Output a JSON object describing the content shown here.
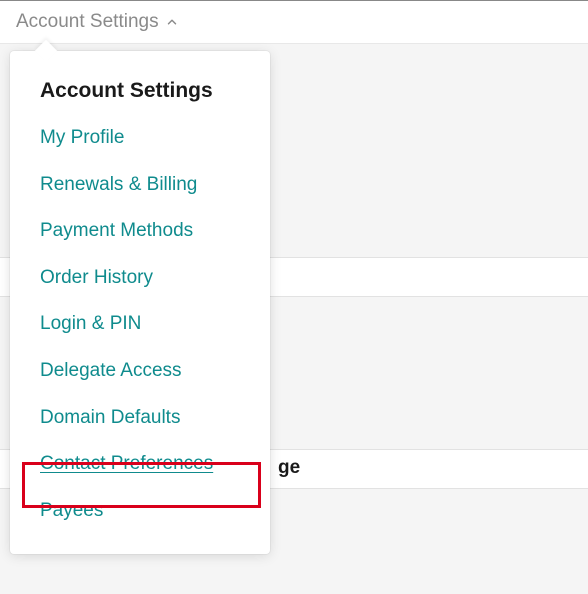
{
  "topbar": {
    "label": "Account Settings"
  },
  "dropdown": {
    "header": "Account Settings",
    "items": [
      {
        "label": "My Profile"
      },
      {
        "label": "Renewals & Billing"
      },
      {
        "label": "Payment Methods"
      },
      {
        "label": "Order History"
      },
      {
        "label": "Login & PIN"
      },
      {
        "label": "Delegate Access"
      },
      {
        "label": "Domain Defaults"
      },
      {
        "label": "Contact Preferences"
      },
      {
        "label": "Payees"
      }
    ]
  },
  "background": {
    "partial_text": "ge"
  }
}
